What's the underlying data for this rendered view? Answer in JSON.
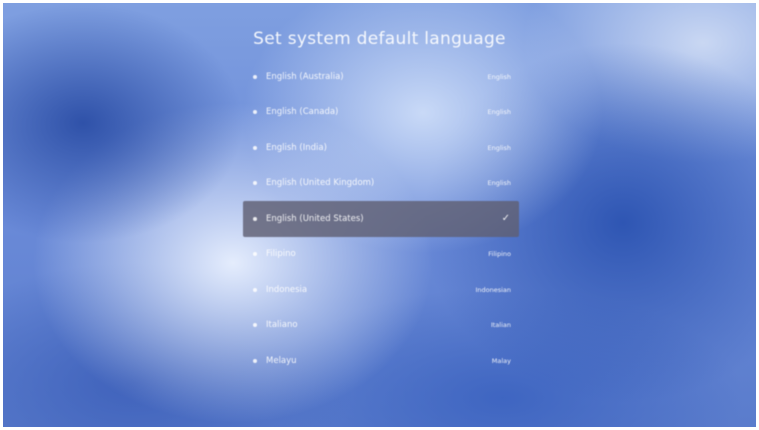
{
  "page": {
    "title": "Set system default language"
  },
  "languages": [
    {
      "label": "English (Australia)",
      "native": "English",
      "selected": false
    },
    {
      "label": "English (Canada)",
      "native": "English",
      "selected": false
    },
    {
      "label": "English (India)",
      "native": "English",
      "selected": false
    },
    {
      "label": "English (United Kingdom)",
      "native": "English",
      "selected": false
    },
    {
      "label": "English (United States)",
      "native": "",
      "selected": true
    },
    {
      "label": "Filipino",
      "native": "Filipino",
      "selected": false
    },
    {
      "label": "Indonesia",
      "native": "Indonesian",
      "selected": false
    },
    {
      "label": "Italiano",
      "native": "Italian",
      "selected": false
    },
    {
      "label": "Melayu",
      "native": "Malay",
      "selected": false
    }
  ],
  "icons": {
    "check": "✓",
    "bullet": "bullet-dot-icon"
  },
  "colors": {
    "selected_row": "#5f5f73",
    "text": "#ffffff",
    "background_blue": "#6a8ad8"
  }
}
